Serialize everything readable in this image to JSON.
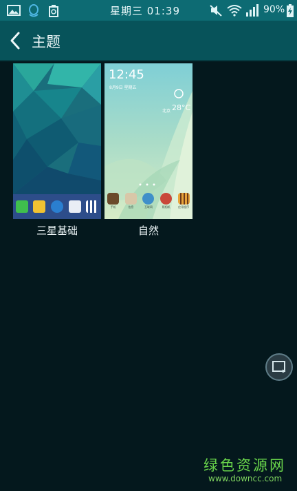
{
  "status_bar": {
    "left_icons": [
      "gallery-icon",
      "qq-icon",
      "recycle-icon"
    ],
    "time": "星期三 01:39",
    "right_icons": [
      "mute-icon",
      "wifi-icon",
      "signal-icon"
    ],
    "battery_percent": "90%"
  },
  "action_bar": {
    "back_icon": "chevron-left-icon",
    "title": "主题"
  },
  "themes": [
    {
      "label": "三星基础",
      "dock_icons": [
        "phone-icon",
        "email-icon",
        "browser-icon",
        "camera-icon",
        "apps-grid-icon"
      ]
    },
    {
      "label": "自然",
      "lock_time": "12:45",
      "lock_date": "8月9日 星期五",
      "weather_city": "北京",
      "weather_temp": "28°C",
      "dock_icons": [
        "contacts-icon",
        "gallery-icon",
        "browser-icon",
        "camera-icon",
        "apps-grid-icon"
      ],
      "dock_labels": [
        "手机",
        "信息",
        "互联网",
        "照相机",
        "应用程序"
      ]
    }
  ],
  "floating_button_icon": "screen-rotate-icon",
  "watermark": {
    "text": "绿色资源网",
    "url": "www.downcc.com"
  },
  "colors": {
    "status_bar": "#0d6b73",
    "action_bar": "#07535a",
    "background": "#04181d",
    "watermark": "#69d54b"
  }
}
